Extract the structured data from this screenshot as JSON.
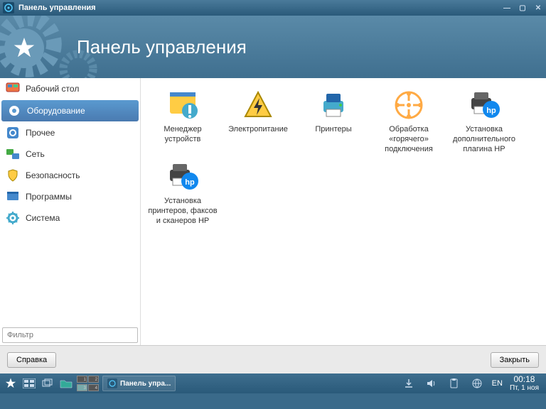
{
  "window": {
    "title": "Панель управления"
  },
  "header": {
    "title": "Панель управления"
  },
  "sidebar": {
    "items": [
      {
        "label": "Рабочий стол",
        "icon": "desktop",
        "active": false
      },
      {
        "label": "Оборудование",
        "icon": "hardware",
        "active": true
      },
      {
        "label": "Прочее",
        "icon": "other",
        "active": false
      },
      {
        "label": "Сеть",
        "icon": "network",
        "active": false
      },
      {
        "label": "Безопасность",
        "icon": "security",
        "active": false
      },
      {
        "label": "Программы",
        "icon": "programs",
        "active": false
      },
      {
        "label": "Система",
        "icon": "system",
        "active": false
      }
    ],
    "filter_placeholder": "Фильтр"
  },
  "grid": {
    "items": [
      {
        "label": "Менеджер устройств",
        "icon": "device-manager"
      },
      {
        "label": "Электропитание",
        "icon": "power"
      },
      {
        "label": "Принтеры",
        "icon": "printers"
      },
      {
        "label": "Обработка «горячего» подключения",
        "icon": "hotplug"
      },
      {
        "label": "Установка дополнительного плагина HP",
        "icon": "hp-plugin"
      },
      {
        "label": "Установка принтеров, факсов и сканеров HP",
        "icon": "hp-setup"
      }
    ]
  },
  "buttons": {
    "help": "Справка",
    "close": "Закрыть"
  },
  "taskbar": {
    "app_label": "Панель упра...",
    "lang": "EN",
    "clock_time": "00:18",
    "clock_date": "Пт, 1 ноя"
  }
}
